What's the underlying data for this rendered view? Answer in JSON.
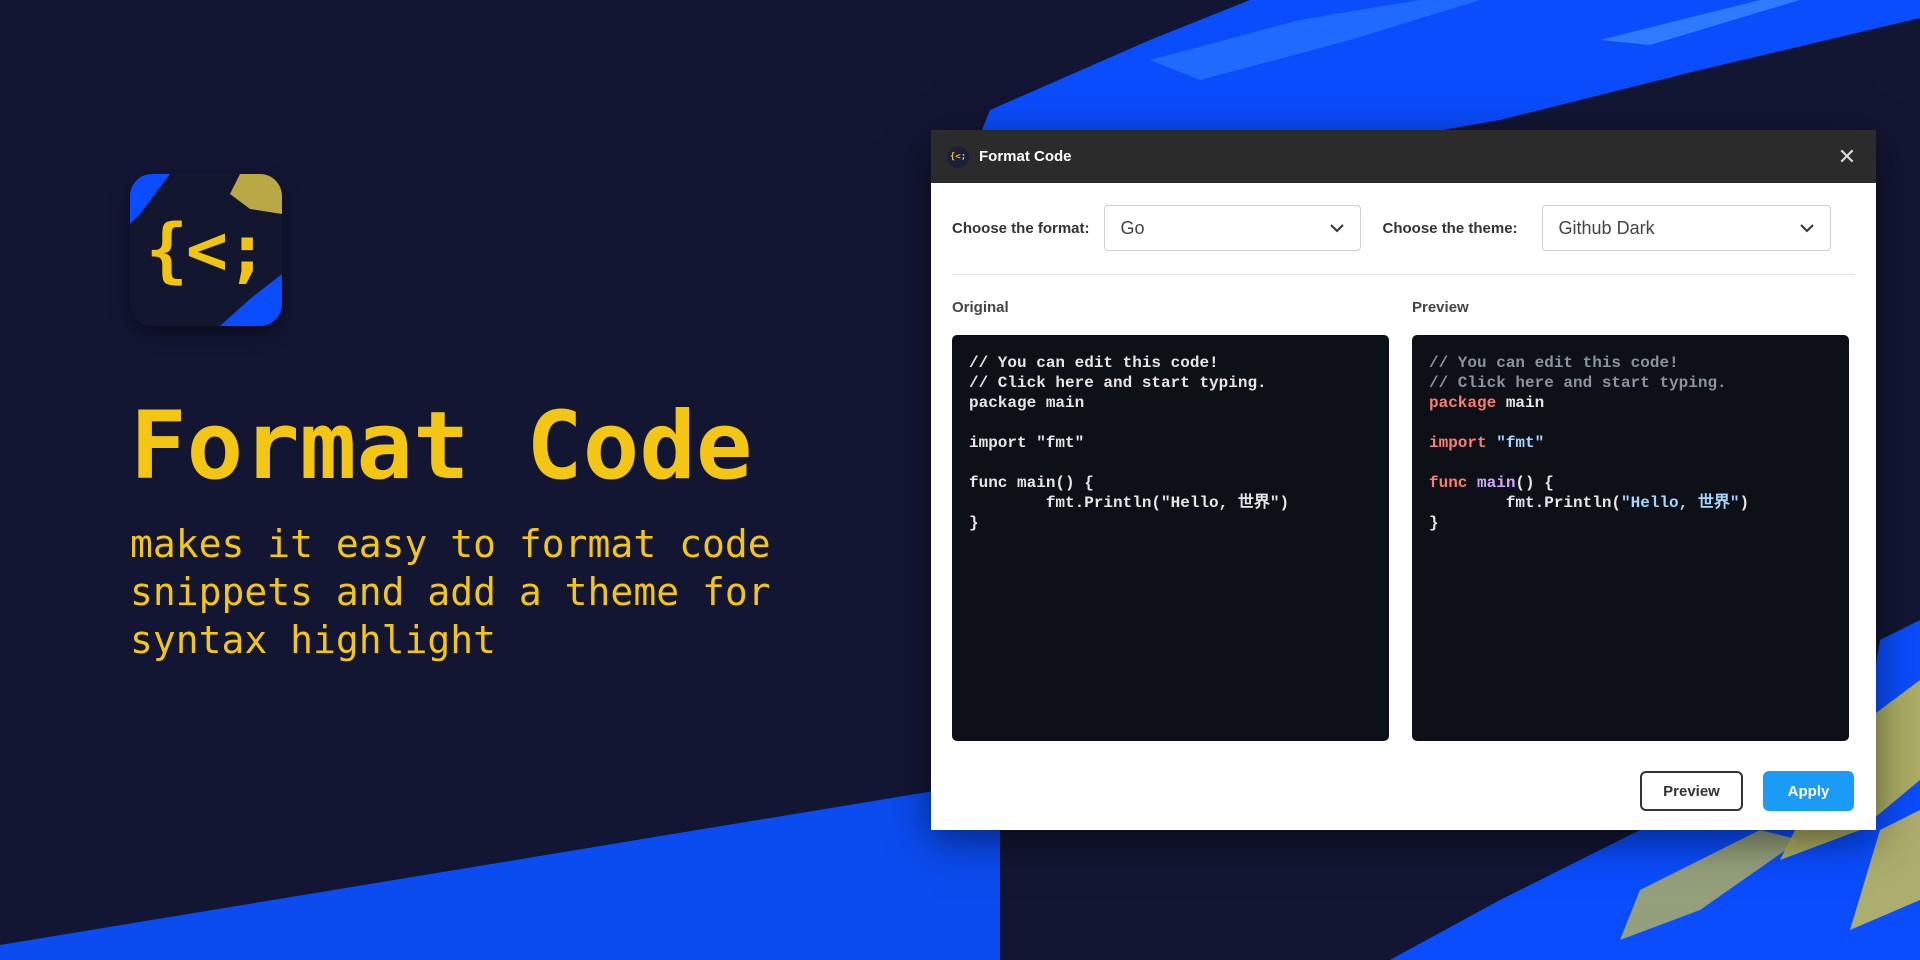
{
  "hero": {
    "icon_text": "{<;",
    "title": "Format Code",
    "subtitle_lines": [
      "makes it easy to format code",
      "snippets and add a theme for",
      "syntax highlight"
    ]
  },
  "dialog": {
    "title": "Format Code",
    "format_label": "Choose the format:",
    "format_value": "Go",
    "theme_label": "Choose the theme:",
    "theme_value": "Github Dark",
    "original_label": "Original",
    "preview_label": "Preview",
    "code_lines": [
      "// You can edit this code!",
      "// Click here and start typing.",
      "package main",
      "",
      "import \"fmt\"",
      "",
      "func main() {",
      "        fmt.Println(\"Hello, 世界\")",
      "}"
    ],
    "preview_button": "Preview",
    "apply_button": "Apply"
  },
  "colors": {
    "background": "#121633",
    "accent_yellow": "#f3c614",
    "brush_blue": "#0a4dff",
    "apply_blue": "#1a9bf5",
    "code_bg": "#0d1117"
  },
  "icons": [
    "app-logo-icon",
    "close-icon",
    "chevron-down-icon"
  ]
}
